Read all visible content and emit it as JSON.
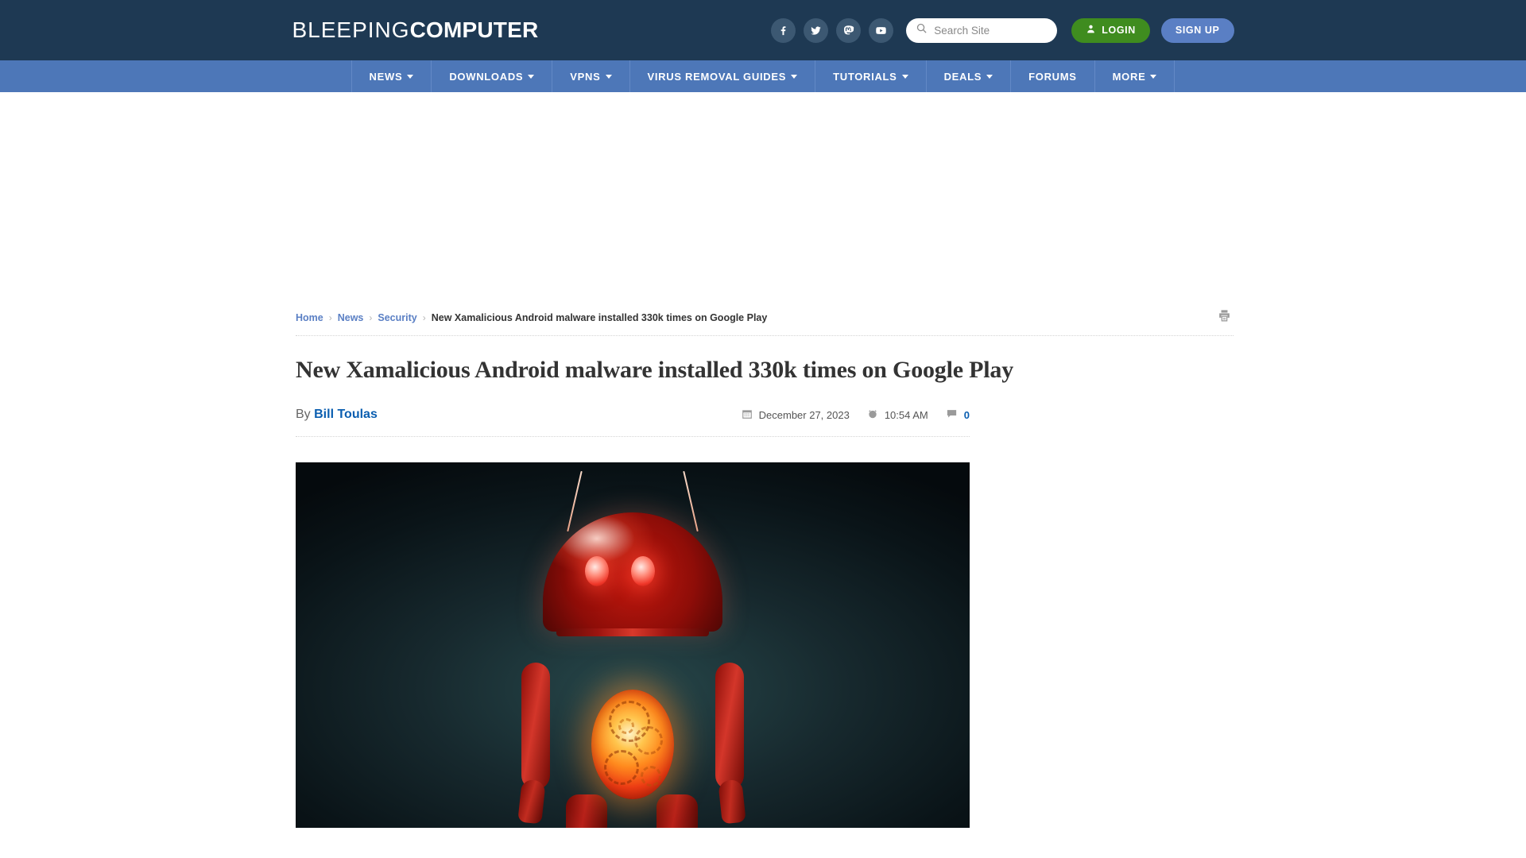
{
  "header": {
    "logo_thin": "BLEEPING",
    "logo_bold": "COMPUTER",
    "social": [
      {
        "name": "facebook-icon",
        "label": "Facebook"
      },
      {
        "name": "twitter-icon",
        "label": "Twitter"
      },
      {
        "name": "mastodon-icon",
        "label": "Mastodon"
      },
      {
        "name": "youtube-icon",
        "label": "YouTube"
      }
    ],
    "search": {
      "placeholder": "Search Site",
      "value": ""
    },
    "login_label": "LOGIN",
    "signup_label": "SIGN UP",
    "bg_color": "#1e3953",
    "login_color": "#3f8c1f",
    "signup_color": "#5a7fc4"
  },
  "nav": {
    "bg_color": "#4d77b8",
    "items": [
      {
        "label": "NEWS",
        "has_dropdown": true
      },
      {
        "label": "DOWNLOADS",
        "has_dropdown": true
      },
      {
        "label": "VPNS",
        "has_dropdown": true
      },
      {
        "label": "VIRUS REMOVAL GUIDES",
        "has_dropdown": true
      },
      {
        "label": "TUTORIALS",
        "has_dropdown": true
      },
      {
        "label": "DEALS",
        "has_dropdown": true
      },
      {
        "label": "FORUMS",
        "has_dropdown": false
      },
      {
        "label": "MORE",
        "has_dropdown": true
      }
    ]
  },
  "breadcrumb": {
    "items": [
      {
        "label": "Home",
        "is_link": true
      },
      {
        "label": "News",
        "is_link": true
      },
      {
        "label": "Security",
        "is_link": true
      },
      {
        "label": "New Xamalicious Android malware installed 330k times on Google Play",
        "is_link": false
      }
    ],
    "separator": "›"
  },
  "article": {
    "title": "New Xamalicious Android malware installed 330k times on Google Play",
    "byline_prefix": "By",
    "author": "Bill Toulas",
    "date": "December 27, 2023",
    "time": "10:54 AM",
    "comment_count": "0",
    "image_alt": "Red Android robot with glowing eyes and exposed glowing gear chest"
  }
}
